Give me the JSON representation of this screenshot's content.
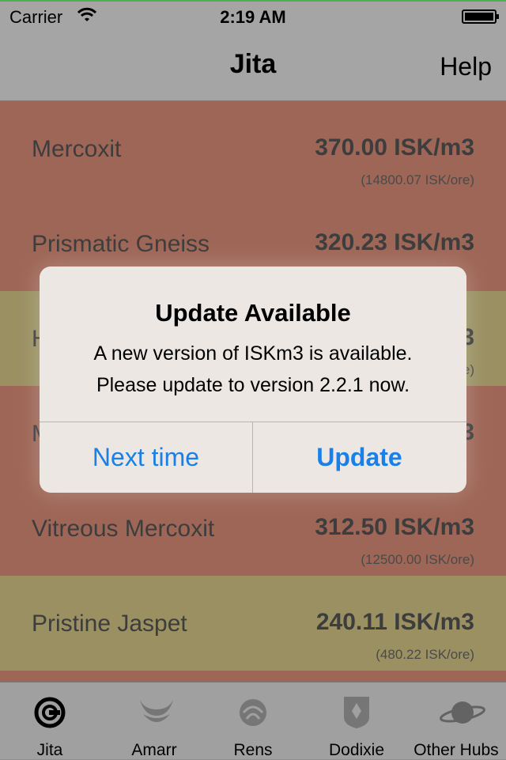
{
  "status": {
    "carrier": "Carrier",
    "time": "2:19 AM"
  },
  "nav": {
    "title": "Jita",
    "help": "Help"
  },
  "rows": [
    {
      "name": "Mercoxit",
      "price": "370.00 ISK/m3",
      "ore": "(14800.07 ISK/ore)",
      "color": "#9e6657"
    },
    {
      "name": "Prismatic Gneiss",
      "price": "320.23 ISK/m3",
      "ore": "",
      "color": "#9e6657"
    },
    {
      "name": "H",
      "price": "3",
      "ore": "e)",
      "color": "#9a9062"
    },
    {
      "name": "M",
      "price": "3",
      "ore": "",
      "color": "#9e6657"
    },
    {
      "name": "Vitreous Mercoxit",
      "price": "312.50 ISK/m3",
      "ore": "(12500.00 ISK/ore)",
      "color": "#9e6657"
    },
    {
      "name": "Pristine Jaspet",
      "price": "240.11 ISK/m3",
      "ore": "(480.22 ISK/ore)",
      "color": "#9a9062"
    }
  ],
  "tabs": [
    {
      "label": "Jita",
      "icon": "jita-icon"
    },
    {
      "label": "Amarr",
      "icon": "amarr-icon"
    },
    {
      "label": "Rens",
      "icon": "rens-icon"
    },
    {
      "label": "Dodixie",
      "icon": "dodixie-icon"
    },
    {
      "label": "Other Hubs",
      "icon": "planet-icon"
    }
  ],
  "alert": {
    "title": "Update Available",
    "message_line1": "A new version of ISKm3 is available.",
    "message_line2": "Please update to version 2.2.1 now.",
    "cancel": "Next time",
    "confirm": "Update"
  },
  "colors": {
    "accent": "#1a7fe6",
    "row_red": "#9e6657",
    "row_yellow": "#9a9062"
  }
}
